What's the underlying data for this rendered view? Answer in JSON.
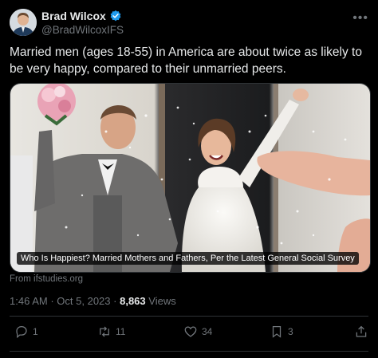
{
  "author": {
    "name": "Brad Wilcox",
    "handle": "@BradWilcoxIFS",
    "verified_icon": "verified-badge-icon",
    "more_icon": "ellipsis-icon"
  },
  "tweet": {
    "text": "Married men (ages 18-55) in America are about twice as likely to be very happy, compared to their unmarried peers."
  },
  "card": {
    "caption": "Who Is Happiest? Married Mothers and Fathers, Per the Latest General Social Survey",
    "source": "From ifstudies.org"
  },
  "meta": {
    "time": "1:46 AM",
    "separator": "·",
    "date": "Oct 5, 2023",
    "views_count": "8,863",
    "views_label": "Views"
  },
  "actions": {
    "reply_count": "1",
    "retweet_count": "11",
    "like_count": "34",
    "bookmark_count": "3"
  },
  "colors": {
    "background": "#000000",
    "text": "#e7e9ea",
    "muted": "#71767b",
    "verified": "#1d9bf0"
  }
}
